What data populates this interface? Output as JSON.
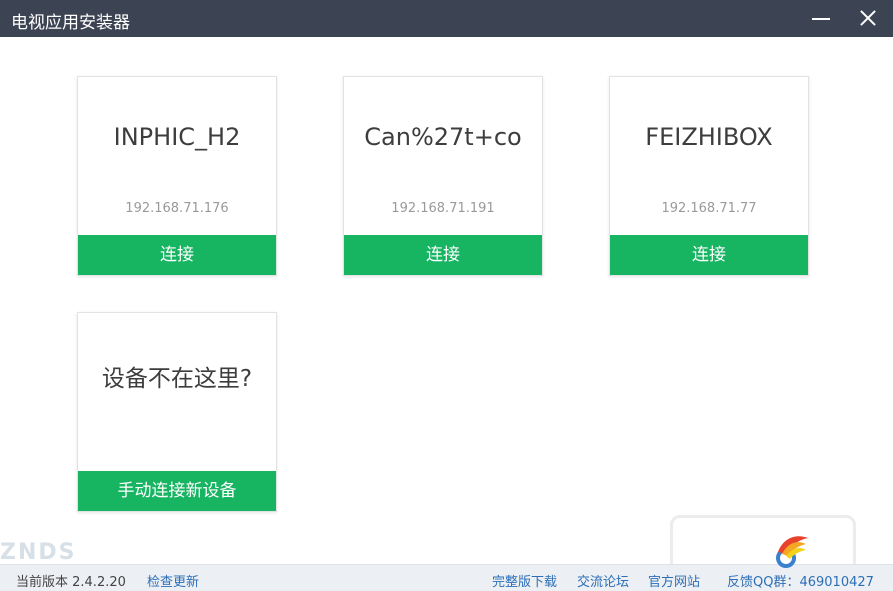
{
  "window": {
    "title": "电视应用安装器"
  },
  "devices": [
    {
      "name": "INPHIC_H2",
      "ip": "192.168.71.176",
      "button_label": "连接"
    },
    {
      "name": "Can%27t+co",
      "ip": "192.168.71.191",
      "button_label": "连接"
    },
    {
      "name": "FEIZHIBOX",
      "ip": "192.168.71.77",
      "button_label": "连接"
    }
  ],
  "manual": {
    "title": "设备不在这里?",
    "button_label": "手动连接新设备"
  },
  "footer": {
    "version_text": "当前版本 2.4.2.20",
    "check_update": "检查更新",
    "full_download": "完整版下载",
    "forum": "交流论坛",
    "official_site": "官方网站",
    "feedback_qq": "反馈QQ群：469010427"
  },
  "watermark": {
    "text": "ZNDS"
  },
  "colors": {
    "titlebar": "#3c4352",
    "button_green": "#17b462",
    "link_blue": "#2c6fb7"
  }
}
